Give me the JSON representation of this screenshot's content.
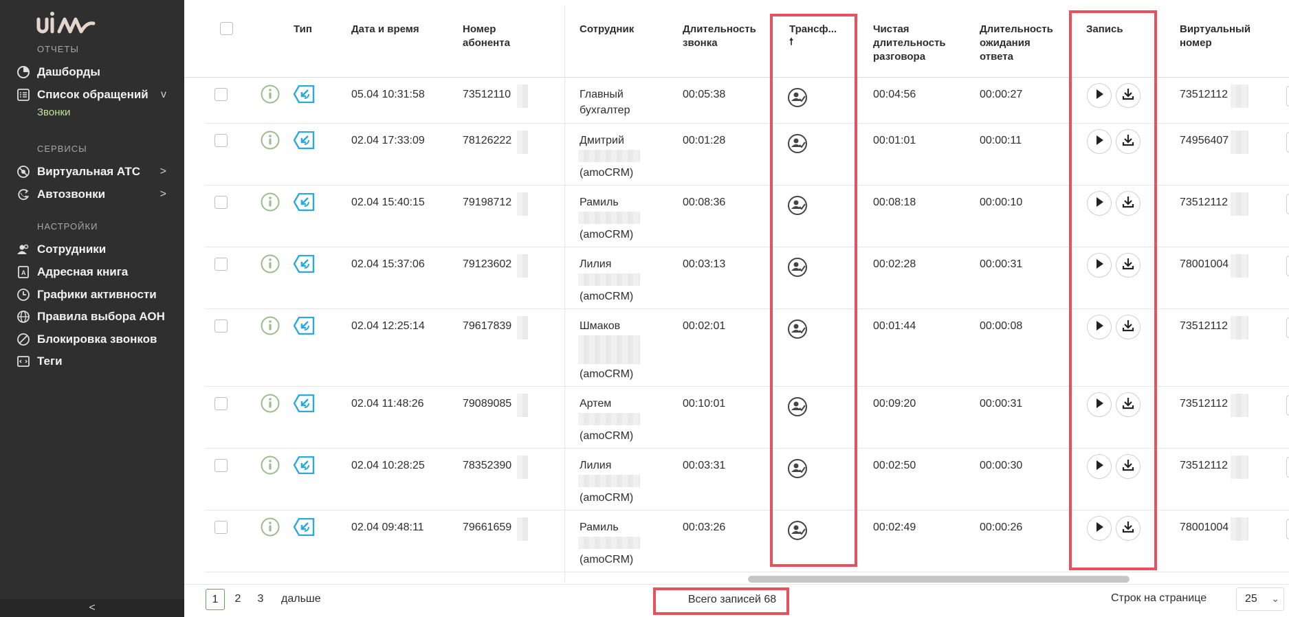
{
  "sidebar": {
    "sections": {
      "reports": "ОТЧЕТЫ",
      "services": "СЕРВИСЫ",
      "settings": "НАСТРОЙКИ"
    },
    "items": [
      {
        "label": "Дашборды",
        "icon": "pie-chart-icon"
      },
      {
        "label": "Список обращений",
        "icon": "list-icon",
        "arrow": "v"
      },
      {
        "label": "Виртуальная АТС",
        "icon": "pbx-icon",
        "arrow": ">"
      },
      {
        "label": "Автозвонки",
        "icon": "autocall-icon",
        "arrow": ">"
      },
      {
        "label": "Сотрудники",
        "icon": "users-icon"
      },
      {
        "label": "Адресная книга",
        "icon": "address-book-icon"
      },
      {
        "label": "Графики активности",
        "icon": "clock-icon"
      },
      {
        "label": "Правила выбора АОН",
        "icon": "globe-icon"
      },
      {
        "label": "Блокировка звонков",
        "icon": "block-icon"
      },
      {
        "label": "Теги",
        "icon": "tag-icon"
      }
    ],
    "sub_item": "Звонки",
    "collapse_label": "<",
    "accent_color": "#bfe59d"
  },
  "table": {
    "headers": {
      "type": "Тип",
      "datetime": "Дата и время",
      "subscriber": "Номер абонента",
      "employee": "Сотрудник",
      "duration": "Длительность звонка",
      "transfer": "Трансф...",
      "transfer_sort": "🠕",
      "net_duration": "Чистая длительность разговора",
      "wait_duration": "Длительность ожидания ответа",
      "record": "Запись",
      "virtual_number": "Виртуальный номер"
    },
    "rows": [
      {
        "datetime": "05.04 10:31:58",
        "subscriber": "73512110",
        "emp_line1": "Главный",
        "emp_line2": "бухгалтер",
        "emp_line3": "",
        "duration": "00:05:38",
        "net": "00:04:56",
        "wait": "00:00:27",
        "virtual": "73512112"
      },
      {
        "datetime": "02.04 17:33:09",
        "subscriber": "78126222",
        "emp_line1": "Дмитрий",
        "emp_line2": "",
        "emp_line3": "(amoCRM)",
        "duration": "00:01:28",
        "net": "00:01:01",
        "wait": "00:00:11",
        "virtual": "74956407"
      },
      {
        "datetime": "02.04 15:40:15",
        "subscriber": "79198712",
        "emp_line1": "Рамиль",
        "emp_line2": "",
        "emp_line3": "(amoCRM)",
        "duration": "00:08:36",
        "net": "00:08:18",
        "wait": "00:00:10",
        "virtual": "73512112"
      },
      {
        "datetime": "02.04 15:37:06",
        "subscriber": "79123602",
        "emp_line1": "Лилия",
        "emp_line2": "",
        "emp_line3": "(amoCRM)",
        "duration": "00:03:13",
        "net": "00:02:28",
        "wait": "00:00:31",
        "virtual": "78001004"
      },
      {
        "datetime": "02.04 12:25:14",
        "subscriber": "79617839",
        "emp_line1": "Шмаков",
        "emp_line2": "",
        "emp_line3": "(amoCRM)",
        "duration": "00:02:01",
        "net": "00:01:44",
        "wait": "00:00:08",
        "virtual": "73512112"
      },
      {
        "datetime": "02.04 11:48:26",
        "subscriber": "79089085",
        "emp_line1": "Артем",
        "emp_line2": "",
        "emp_line3": "(amoCRM)",
        "duration": "00:10:01",
        "net": "00:09:20",
        "wait": "00:00:31",
        "virtual": "73512112"
      },
      {
        "datetime": "02.04 10:28:25",
        "subscriber": "78352390",
        "emp_line1": "Лилия",
        "emp_line2": "",
        "emp_line3": "(amoCRM)",
        "duration": "00:03:31",
        "net": "00:02:50",
        "wait": "00:00:30",
        "virtual": "73512112"
      },
      {
        "datetime": "02.04 09:48:11",
        "subscriber": "79661659",
        "emp_line1": "Рамиль",
        "emp_line2": "",
        "emp_line3": "(amoCRM)",
        "duration": "00:03:26",
        "net": "00:02:49",
        "wait": "00:00:26",
        "virtual": "78001004"
      }
    ]
  },
  "footer": {
    "pages": [
      "1",
      "2",
      "3"
    ],
    "next_label": "дальше",
    "total_label": "Всего записей 68",
    "rows_per_page_label": "Строк на странице",
    "rows_per_page_value": "25"
  },
  "colors": {
    "highlight": "#e9505e",
    "type_icon": "#2aa9e0",
    "info_icon": "#9bbd8a"
  }
}
